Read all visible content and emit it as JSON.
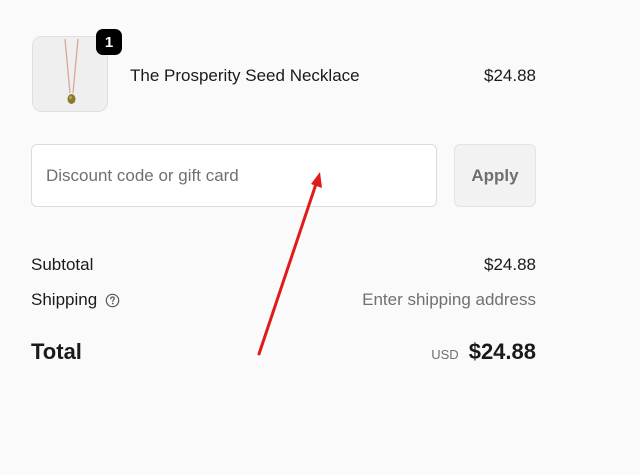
{
  "cart": {
    "items": [
      {
        "name": "The Prosperity Seed Necklace",
        "price": "$24.88",
        "quantity": "1",
        "image_icon": "necklace-image"
      }
    ]
  },
  "discount": {
    "placeholder": "Discount code or gift card",
    "apply_label": "Apply"
  },
  "summary": {
    "subtotal_label": "Subtotal",
    "subtotal_value": "$24.88",
    "shipping_label": "Shipping",
    "shipping_value": "Enter shipping address",
    "shipping_help_icon": "question-circle-icon",
    "total_label": "Total",
    "currency": "USD",
    "total_value": "$24.88"
  },
  "colors": {
    "background": "#fafafa",
    "badge": "#000000",
    "annotation_arrow": "#e01b1b",
    "muted_text": "#707070"
  }
}
